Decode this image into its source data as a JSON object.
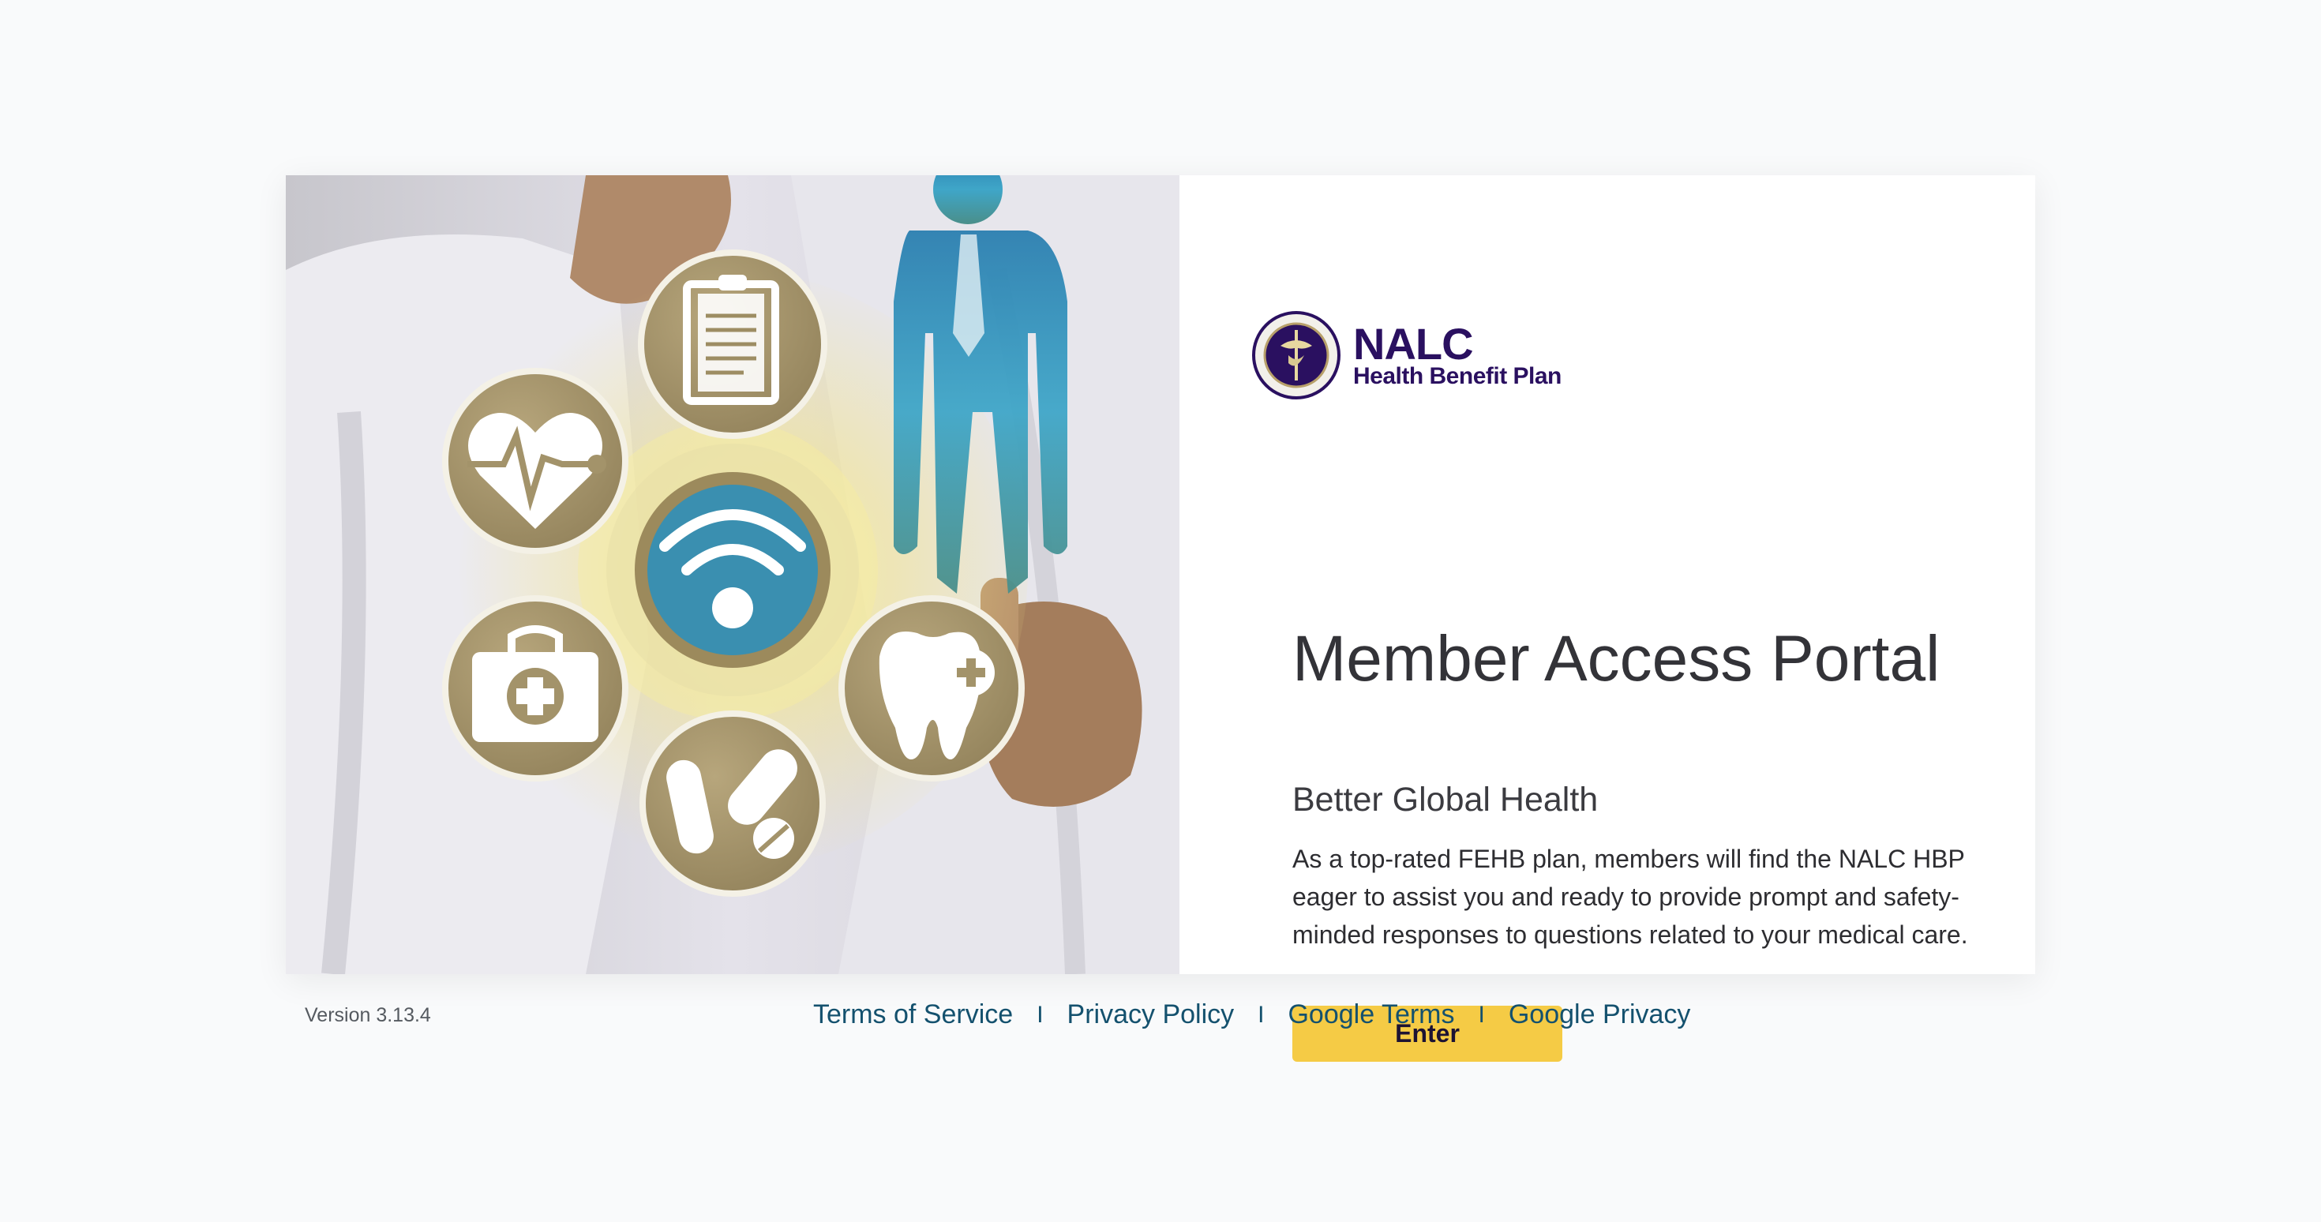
{
  "logo": {
    "name": "NALC",
    "subtitle": "Health Benefit Plan"
  },
  "main": {
    "title": "Member Access Portal",
    "subtitle": "Better Global Health",
    "description": "As a top-rated FEHB plan, members will find the NALC HBP eager to assist you and ready to provide prompt and safety-minded responses to questions related to your medical care.",
    "enter_label": "Enter"
  },
  "footer": {
    "version": "Version 3.13.4",
    "links": [
      "Terms of Service",
      "Privacy Policy",
      "Google Terms",
      "Google Privacy"
    ],
    "separator": "I"
  },
  "hero": {
    "icons": [
      "clipboard-icon",
      "heart-pulse-icon",
      "wifi-icon",
      "first-aid-kit-icon",
      "pills-icon",
      "tooth-icon",
      "person-icon"
    ]
  },
  "colors": {
    "background": "#f9fafb",
    "brand": "#2a1060",
    "button": "#f5cb45",
    "link": "#14516e"
  }
}
